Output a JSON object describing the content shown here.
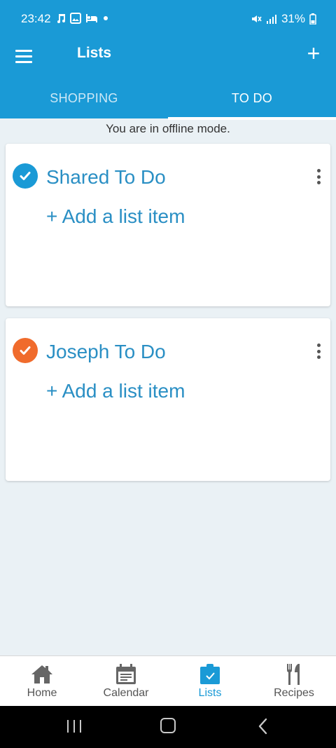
{
  "status": {
    "time": "23:42",
    "battery": "31%",
    "left_icons": [
      "music-icon",
      "image-icon",
      "bed-icon",
      "dot-icon"
    ],
    "right_icons": [
      "mute-icon",
      "signal-icon",
      "battery-icon"
    ]
  },
  "appbar": {
    "title": "Lists",
    "add_symbol": "+"
  },
  "tabs": [
    {
      "label": "SHOPPING",
      "active": false
    },
    {
      "label": "TO DO",
      "active": true
    }
  ],
  "offline_message": "You are in offline mode.",
  "lists": [
    {
      "title": "Shared To Do",
      "add_item_label": "+ Add a list item",
      "check_color": "#1a9ad6"
    },
    {
      "title": "Joseph To Do",
      "add_item_label": "+ Add a list item",
      "check_color": "#f06b2c"
    }
  ],
  "bottom_nav": [
    {
      "label": "Home",
      "icon": "home-icon",
      "active": false
    },
    {
      "label": "Calendar",
      "icon": "calendar-icon",
      "active": false
    },
    {
      "label": "Lists",
      "icon": "lists-icon",
      "active": true
    },
    {
      "label": "Recipes",
      "icon": "recipes-icon",
      "active": false
    }
  ],
  "colors": {
    "primary": "#1a9ad6",
    "accent_orange": "#f06b2c",
    "title_blue": "#2a8fc4"
  }
}
